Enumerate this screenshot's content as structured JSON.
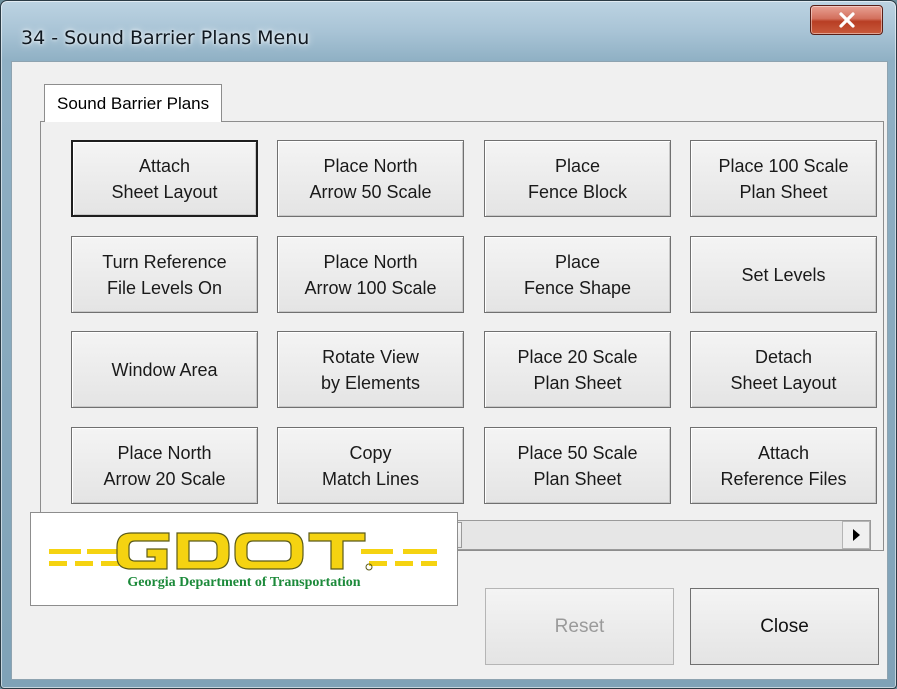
{
  "window": {
    "title": "34 - Sound Barrier Plans Menu"
  },
  "tabs": [
    {
      "label": "Sound Barrier Plans",
      "active": true
    }
  ],
  "grid_buttons": [
    [
      "Attach\nSheet Layout",
      "Place North\nArrow 50 Scale",
      "Place\nFence Block",
      "Place 100 Scale\nPlan Sheet"
    ],
    [
      "Turn Reference\nFile Levels On",
      "Place North\nArrow 100 Scale",
      "Place\nFence Shape",
      "Set Levels"
    ],
    [
      "Window Area",
      "Rotate View\nby Elements",
      "Place 20 Scale\nPlan Sheet",
      "Detach\nSheet Layout"
    ],
    [
      "Place North\nArrow 20 Scale",
      "Copy\nMatch Lines",
      "Place 50 Scale\nPlan Sheet",
      "Attach\nReference Files"
    ]
  ],
  "logo": {
    "wordmark": "GDOT",
    "subtitle": "Georgia Department of Transportation",
    "colors": {
      "yellow": "#f5d311",
      "green": "#1c8a3a"
    }
  },
  "actions": {
    "reset_label": "Reset",
    "reset_enabled": false,
    "close_label": "Close"
  },
  "icons": {
    "close": "close-icon",
    "scroll_left": "left-arrow-icon",
    "scroll_right": "right-arrow-icon"
  }
}
